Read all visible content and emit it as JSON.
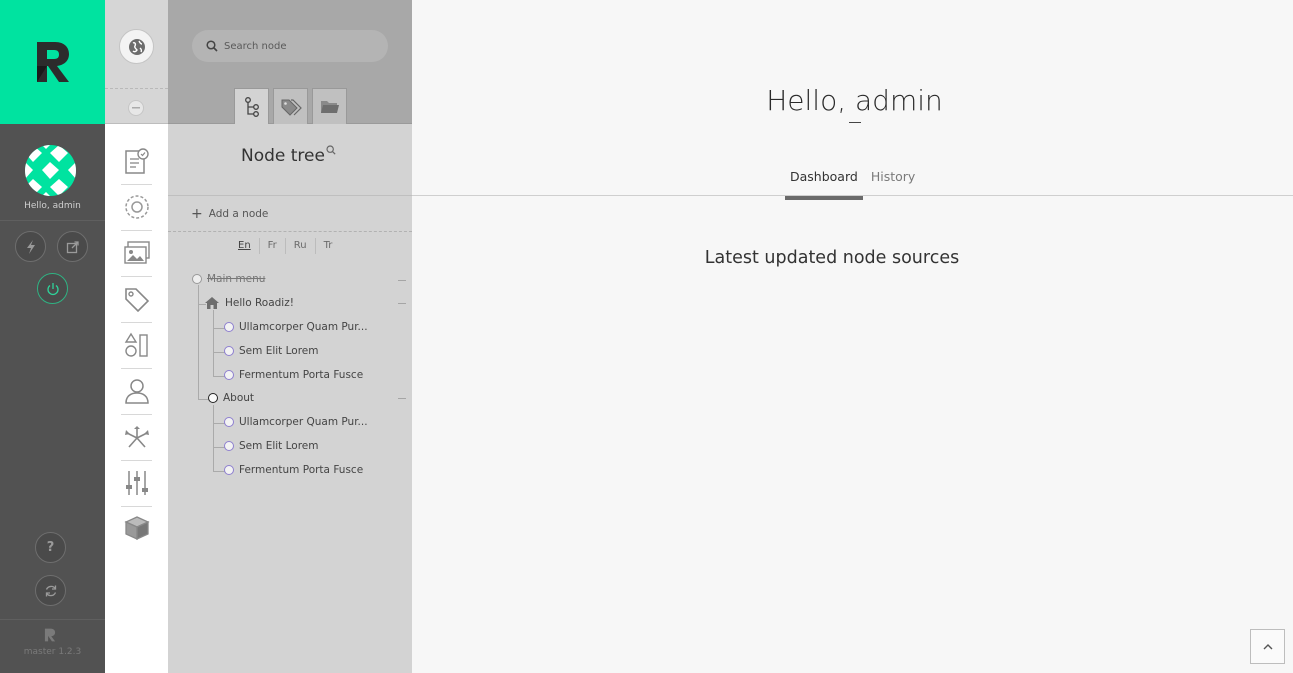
{
  "rail": {
    "greeting": "Hello, admin",
    "version": "master 1.2.3",
    "brand_color": "#00e3a0",
    "quick_buttons": [
      "flash-icon",
      "external-icon"
    ],
    "power": "power-icon",
    "help": "?",
    "refresh": "refresh-icon"
  },
  "nav": {
    "items": [
      "dashboard-icon",
      "settings-icon",
      "documents-icon",
      "tag-icon",
      "shapes-icon",
      "user-icon",
      "network-icon",
      "sliders-icon",
      "box-icon"
    ]
  },
  "treepanel": {
    "search_placeholder": "Search node",
    "tabs": [
      "node-tree-tab",
      "tags-tab",
      "folders-tab"
    ],
    "title": "Node tree",
    "add_node": "Add a node",
    "languages": [
      "En",
      "Fr",
      "Ru",
      "Tr"
    ],
    "active_language": "En",
    "tree": {
      "root": "Main menu",
      "home": "Hello Roadiz!",
      "home_children": [
        "Ullamcorper Quam Pur...",
        "Sem Elit Lorem",
        "Fermentum Porta Fusce"
      ],
      "about": "About",
      "about_children": [
        "Ullamcorper Quam Pur...",
        "Sem Elit Lorem",
        "Fermentum Porta Fusce"
      ]
    }
  },
  "main": {
    "title": "Hello, admin",
    "tabs": [
      "Dashboard",
      "History"
    ],
    "active_tab": "Dashboard",
    "section_title": "Latest updated node sources"
  }
}
